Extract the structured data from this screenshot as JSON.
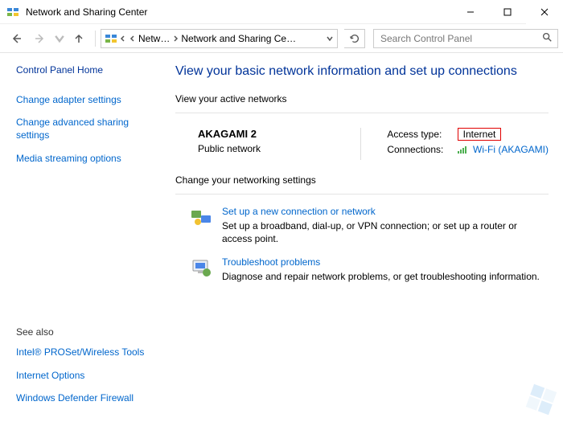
{
  "titlebar": {
    "title": "Network and Sharing Center"
  },
  "breadcrumb": {
    "seg1": "Netw…",
    "seg2": "Network and Sharing Ce…"
  },
  "search": {
    "placeholder": "Search Control Panel"
  },
  "sidebar": {
    "home": "Control Panel Home",
    "links": [
      "Change adapter settings",
      "Change advanced sharing settings",
      "Media streaming options"
    ],
    "seealso_label": "See also",
    "seealso": [
      "Intel® PROSet/Wireless Tools",
      "Internet Options",
      "Windows Defender Firewall"
    ]
  },
  "main": {
    "heading": "View your basic network information and set up connections",
    "active_label": "View your active networks",
    "network": {
      "name": "AKAGAMI 2",
      "type": "Public network",
      "access_label": "Access type:",
      "access_value": "Internet",
      "conn_label": "Connections:",
      "conn_value": "Wi-Fi (AKAGAMI)"
    },
    "change_label": "Change your networking settings",
    "items": [
      {
        "title": "Set up a new connection or network",
        "desc": "Set up a broadband, dial-up, or VPN connection; or set up a router or access point."
      },
      {
        "title": "Troubleshoot problems",
        "desc": "Diagnose and repair network problems, or get troubleshooting information."
      }
    ]
  }
}
